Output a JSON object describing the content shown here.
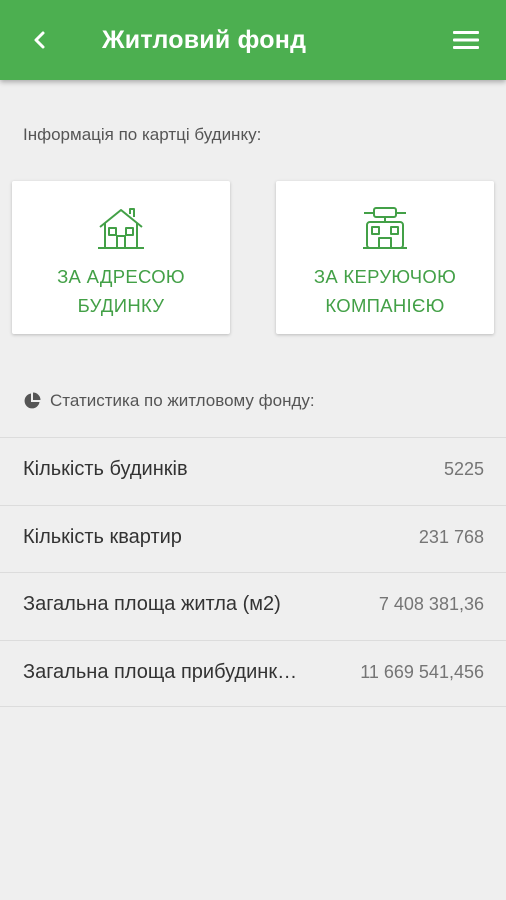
{
  "header": {
    "title": "Житловий фонд",
    "bg_color": "#4caf50",
    "back_icon": "chevron-left-icon",
    "menu_icon": "hamburger-menu-icon"
  },
  "info_section": {
    "label": "Інформація по картці будинку:",
    "cards": [
      {
        "line1": "ЗА АДРЕСОЮ",
        "line2": "БУДИНКУ",
        "icon": "house-icon"
      },
      {
        "line1": "ЗА КЕРУЮЧОЮ",
        "line2": "КОМПАНІЄЮ",
        "icon": "company-building-icon"
      }
    ],
    "accent_color": "#43a047"
  },
  "stats": {
    "label": "Статистика по житловому фонду:",
    "icon": "pie-chart-icon",
    "rows": [
      {
        "label": "Кількість будинків",
        "value": "5225"
      },
      {
        "label": "Кількість квартир",
        "value": "231 768"
      },
      {
        "label": "Загальна площа житла (м2)",
        "value": "7 408 381,36"
      },
      {
        "label": "Загальна площа прибудинк…",
        "value": "11 669 541,456"
      }
    ]
  }
}
